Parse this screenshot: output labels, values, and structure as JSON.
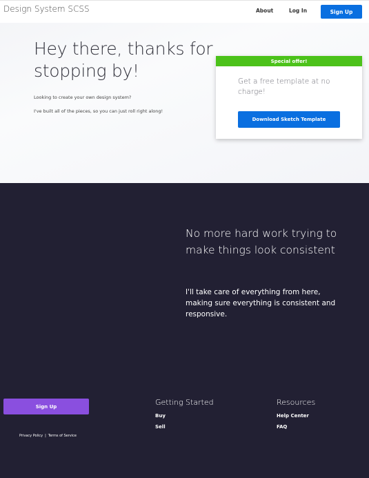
{
  "nav": {
    "brand": "Design System SCSS",
    "links": [
      "About",
      "Log In"
    ],
    "signup_label": "Sign Up"
  },
  "hero": {
    "title": "Hey there, thanks for stopping by!",
    "text_1": "Looking to create your own design system?",
    "text_2": "I've built all of the pieces, so you can just roll right along!"
  },
  "offer": {
    "ribbon": "Special offer!",
    "text": "Get a free template at no charge!",
    "button_label": "Download Sketch Template"
  },
  "feature": {
    "title": "No more hard work trying to make things look consistent",
    "text": "I'll take care of everything from here, making sure everything is consistent and responsive."
  },
  "footer": {
    "signup_label": "Sign Up",
    "legal": {
      "privacy": "Privacy Policy",
      "separator": "|",
      "terms": "Terms of Service"
    },
    "columns": [
      {
        "heading": "Getting Started",
        "links": [
          "Buy",
          "Sell"
        ]
      },
      {
        "heading": "Resources",
        "links": [
          "Help Center",
          "FAQ"
        ]
      }
    ]
  },
  "colors": {
    "primary": "#0a6fe0",
    "offer_green": "#4cc21a",
    "footer_bg": "#222033",
    "footer_button": "#8a4fdf"
  }
}
